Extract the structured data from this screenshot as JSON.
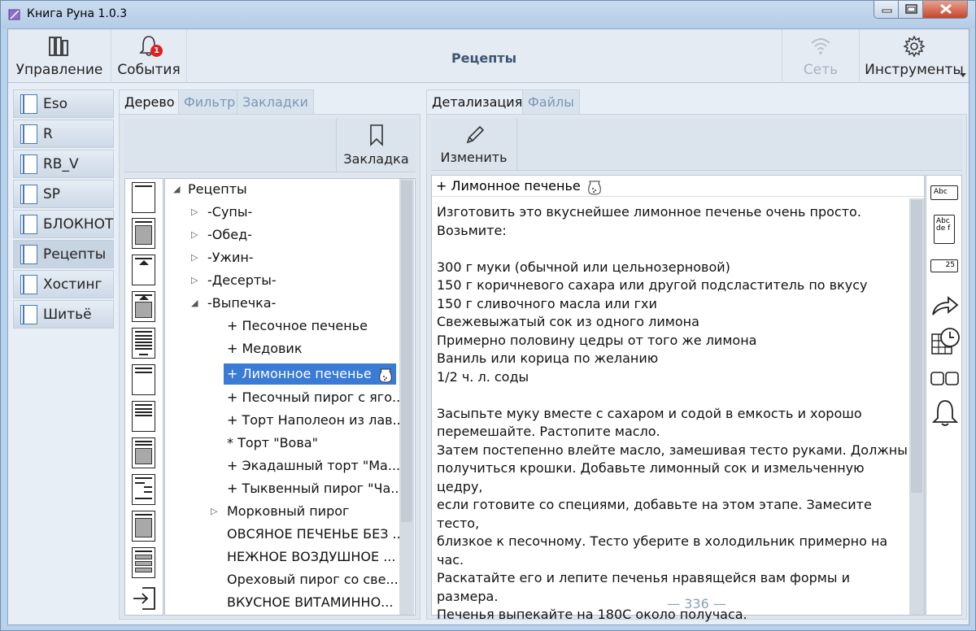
{
  "window": {
    "title": "Книга Руна 1.0.3"
  },
  "toolbar": {
    "manage_label": "Управление",
    "events_label": "События",
    "events_badge": "1",
    "center_title": "Рецепты",
    "network_label": "Сеть",
    "tools_label": "Инструменты"
  },
  "sidebar": {
    "items": [
      {
        "label": "Eso"
      },
      {
        "label": "R"
      },
      {
        "label": "RB_V"
      },
      {
        "label": "SP"
      },
      {
        "label": "БЛОКНОТ"
      },
      {
        "label": "Рецепты",
        "active": true
      },
      {
        "label": "Хостинг"
      },
      {
        "label": "Шитьё"
      }
    ]
  },
  "left_tabs": {
    "tree": "Дерево",
    "filter": "Фильтр",
    "bookmarks": "Закладки"
  },
  "bookmark_button": "Закладка",
  "tree": {
    "items": [
      {
        "label": "Рецепты",
        "depth": 0,
        "arrow": "expanded"
      },
      {
        "label": "-Супы-",
        "depth": 1,
        "arrow": "collapsed"
      },
      {
        "label": "-Обед-",
        "depth": 1,
        "arrow": "collapsed"
      },
      {
        "label": "-Ужин-",
        "depth": 1,
        "arrow": "collapsed"
      },
      {
        "label": "-Десерты-",
        "depth": 1,
        "arrow": "collapsed"
      },
      {
        "label": "-Выпечка-",
        "depth": 1,
        "arrow": "expanded"
      },
      {
        "label": "+ Песочное печенье",
        "depth": 2
      },
      {
        "label": "+ Медовик",
        "depth": 2
      },
      {
        "label": "+ Лимонное печенье",
        "depth": 2,
        "selected": true
      },
      {
        "label": "+ Песочный пирог с яго...",
        "depth": 2
      },
      {
        "label": "+ Торт Наполеон из лав...",
        "depth": 2
      },
      {
        "label": "* Торт \"Вова\"",
        "depth": 2
      },
      {
        "label": "+ Экадашный торт \"Ма...",
        "depth": 2
      },
      {
        "label": "+ Тыквенный пирог \"Ча...",
        "depth": 2
      },
      {
        "label": "Морковный пирог",
        "depth": 2,
        "arrow": "collapsed"
      },
      {
        "label": "ОВСЯНОЕ ПЕЧЕНЬЕ БЕЗ ...",
        "depth": 2
      },
      {
        "label": "НЕЖНОЕ ВОЗДУШНОЕ ...",
        "depth": 2
      },
      {
        "label": "Ореховый пирог со све...",
        "depth": 2
      },
      {
        "label": "ВКУСНОЕ ВИТАМИННО...",
        "depth": 2
      }
    ]
  },
  "right_tabs": {
    "details": "Детализация",
    "files": "Файлы"
  },
  "edit_button": "Изменить",
  "detail": {
    "title": "+ Лимонное печенье",
    "body": "Изготовить это вкуснейшее лимонное печенье очень просто.\nВозьмите:\n\n300 г муки (обычной или цельнозерновой)\n150 г коричневого сахара или другой подсластитель по вкусу\n150 г сливочного масла или гхи\nСвежевыжатый сок из одного лимона\nПримерно половину цедры от того же лимона\nВаниль или корица по желанию\n1/2 ч. л. соды\n\nЗасыпьте муку вместе с сахаром и содой в емкость и хорошо\nперемешайте. Растопите масло.\nЗатем постепенно влейте масло, замешивая тесто руками. Должны\nполучиться крошки. Добавьте лимонный сок и измельченную цедру,\nесли готовите со специями, добавьте на этом этапе. Замесите тесто,\nблизкое к песочному. Тесто уберите в холодильник примерно на час.\nРаскатайте его и лепите печенья нравящейся вам формы и размера.\nПеченья выпекайте на 180С около получаса.\n\nБлагодарим за рецепт vduxovku.ru"
  },
  "right_tools": {
    "abc_label": "Abc",
    "abcdef_label": "Abc de f",
    "counter_label": "25"
  },
  "footer": {
    "count": "— 336 —"
  },
  "colors": {
    "selection": "#3a7bd5",
    "accent": "#3e5572",
    "badge": "#e02020"
  }
}
